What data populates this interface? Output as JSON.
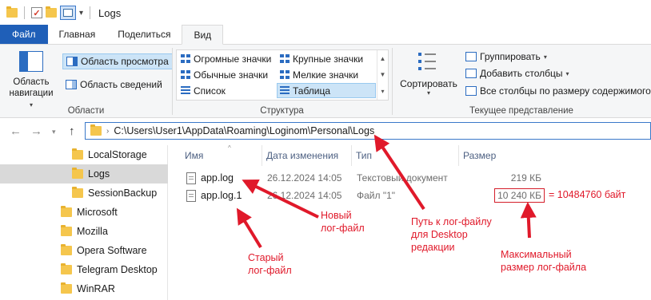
{
  "window": {
    "title": "Logs"
  },
  "ribbon": {
    "tabs": [
      "Файл",
      "Главная",
      "Поделиться",
      "Вид"
    ],
    "active_tab": "Вид",
    "panes": {
      "navigation_pane": "Область навигации",
      "preview_pane": "Область просмотра",
      "details_pane": "Область сведений",
      "group_label": "Области"
    },
    "layout": {
      "items": [
        "Огромные значки",
        "Крупные значки",
        "Обычные значки",
        "Мелкие значки",
        "Список",
        "Таблица"
      ],
      "selected": "Таблица",
      "group_label": "Структура"
    },
    "current_view": {
      "sort_by": "Сортировать",
      "group_by": "Группировать",
      "add_columns": "Добавить столбцы",
      "size_all_columns": "Все столбцы по размеру содержимого",
      "group_label": "Текущее представление"
    }
  },
  "address": {
    "path": "C:\\Users\\User1\\AppData\\Roaming\\Loginom\\Personal\\Logs"
  },
  "navigation": {
    "items": [
      {
        "label": "LocalStorage",
        "selected": false
      },
      {
        "label": "Logs",
        "selected": true
      },
      {
        "label": "SessionBackup",
        "selected": false
      },
      {
        "label": "Microsoft",
        "selected": false
      },
      {
        "label": "Mozilla",
        "selected": false
      },
      {
        "label": "Opera Software",
        "selected": false
      },
      {
        "label": "Telegram Desktop",
        "selected": false
      },
      {
        "label": "WinRAR",
        "selected": false
      }
    ]
  },
  "file_list": {
    "columns": [
      "Имя",
      "Дата изменения",
      "Тип",
      "Размер"
    ],
    "rows": [
      {
        "name": "app.log",
        "modified": "26.12.2024 14:05",
        "type": "Текстовый документ",
        "size": "219 КБ"
      },
      {
        "name": "app.log.1",
        "modified": "26.12.2024 14:05",
        "type": "Файл \"1\"",
        "size": "10 240 КБ"
      }
    ]
  },
  "annotations": {
    "bytes": "= 10484760 байт",
    "new_log": "Новый\nлог-файл",
    "old_log": "Старый\nлог-файл",
    "path_note": "Путь к лог-файлу\nдля Desktop\nредакции",
    "max_size": "Максимальный\nразмер лог-файла",
    "color": "#e0192a"
  }
}
